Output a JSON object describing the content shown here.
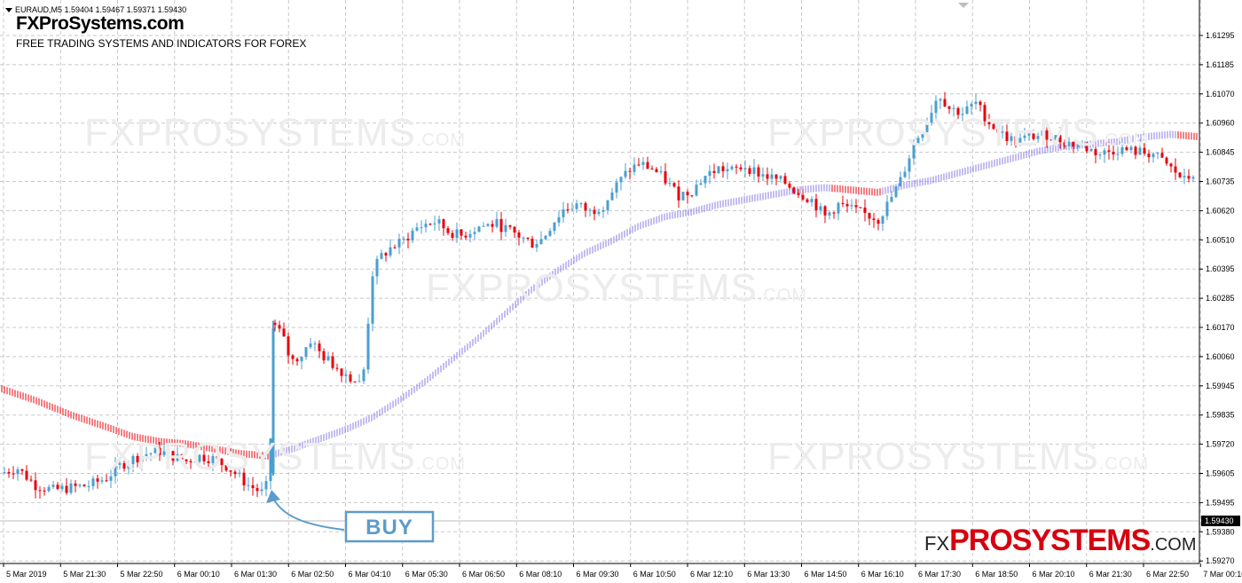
{
  "header": {
    "symbol_line": "EURAUD,M5  1.59404 1.59467 1.59371 1.59430",
    "site_name": "FXProSystems.com",
    "tagline": "FREE TRADING SYSTEMS AND INDICATORS FOR FOREX"
  },
  "watermark": {
    "main": "FXPROSYSTEMS",
    "suffix": ".COM"
  },
  "brand_logo": {
    "prefix": "FX",
    "main": "PROSYSTEMS",
    "suffix": ".COM"
  },
  "buy_label": "BUY",
  "price_labels": [
    "1.61295",
    "1.61185",
    "1.61070",
    "1.60960",
    "1.60845",
    "1.60735",
    "1.60620",
    "1.60510",
    "1.60395",
    "1.60285",
    "1.60170",
    "1.60060",
    "1.59945",
    "1.59835",
    "1.59720",
    "1.59605",
    "1.59495",
    "1.59380",
    "1.59270"
  ],
  "current_price": "1.59430",
  "time_labels": [
    "5 Mar 2019",
    "5 Mar 21:30",
    "5 Mar 22:50",
    "6 Mar 00:10",
    "6 Mar 01:30",
    "6 Mar 02:50",
    "6 Mar 04:10",
    "6 Mar 05:30",
    "6 Mar 06:50",
    "6 Mar 08:10",
    "6 Mar 09:30",
    "6 Mar 10:50",
    "6 Mar 12:10",
    "6 Mar 13:30",
    "6 Mar 14:50",
    "6 Mar 16:10",
    "6 Mar 17:30",
    "6 Mar 18:50",
    "6 Mar 20:10",
    "6 Mar 21:30",
    "6 Mar 22:50",
    "7 Mar 00:10"
  ],
  "colors": {
    "bull": "#4a9fcf",
    "bear": "#e8000b",
    "ma_up": "#8a7ee6",
    "ma_down": "#e8000b",
    "grid": "#c8c8c8",
    "buy_box": "#5d9cc9"
  },
  "chart_data": {
    "type": "candlestick",
    "symbol": "EURAUD",
    "timeframe": "M5",
    "y_range": [
      1.5922,
      1.614
    ],
    "price_series": [
      [
        0,
        1.5959
      ],
      [
        20,
        1.5961
      ],
      [
        40,
        1.5954
      ],
      [
        60,
        1.5952
      ],
      [
        80,
        1.5953
      ],
      [
        100,
        1.5954
      ],
      [
        120,
        1.5957
      ],
      [
        135,
        1.5962
      ],
      [
        150,
        1.5965
      ],
      [
        165,
        1.5967
      ],
      [
        180,
        1.5968
      ],
      [
        195,
        1.5966
      ],
      [
        210,
        1.5964
      ],
      [
        225,
        1.5966
      ],
      [
        240,
        1.5965
      ],
      [
        255,
        1.5962
      ],
      [
        268,
        1.5958
      ],
      [
        280,
        1.5954
      ],
      [
        295,
        1.5951
      ],
      [
        303,
        1.5955
      ],
      [
        310,
        1.602
      ],
      [
        318,
        1.6016
      ],
      [
        328,
        1.6005
      ],
      [
        340,
        1.6008
      ],
      [
        350,
        1.6014
      ],
      [
        362,
        1.6008
      ],
      [
        375,
        1.6004
      ],
      [
        390,
        1.6
      ],
      [
        405,
        1.5996
      ],
      [
        412,
        1.6004
      ],
      [
        418,
        1.604
      ],
      [
        428,
        1.6048
      ],
      [
        440,
        1.6052
      ],
      [
        455,
        1.6055
      ],
      [
        468,
        1.606
      ],
      [
        480,
        1.6062
      ],
      [
        492,
        1.6063
      ],
      [
        505,
        1.6059
      ],
      [
        520,
        1.6057
      ],
      [
        540,
        1.6061
      ],
      [
        560,
        1.6062
      ],
      [
        580,
        1.6058
      ],
      [
        600,
        1.6054
      ],
      [
        612,
        1.6056
      ],
      [
        622,
        1.6062
      ],
      [
        635,
        1.6068
      ],
      [
        650,
        1.607
      ],
      [
        665,
        1.6067
      ],
      [
        680,
        1.607
      ],
      [
        695,
        1.6078
      ],
      [
        708,
        1.6084
      ],
      [
        720,
        1.6087
      ],
      [
        735,
        1.6085
      ],
      [
        750,
        1.608
      ],
      [
        765,
        1.6074
      ],
      [
        780,
        1.6076
      ],
      [
        795,
        1.6082
      ],
      [
        810,
        1.6085
      ],
      [
        825,
        1.6084
      ],
      [
        840,
        1.6086
      ],
      [
        855,
        1.6083
      ],
      [
        870,
        1.6081
      ],
      [
        885,
        1.6079
      ],
      [
        900,
        1.6075
      ],
      [
        915,
        1.6072
      ],
      [
        930,
        1.6065
      ],
      [
        945,
        1.607
      ],
      [
        960,
        1.6068
      ],
      [
        975,
        1.6066
      ],
      [
        990,
        1.6064
      ],
      [
        1002,
        1.6071
      ],
      [
        1015,
        1.608
      ],
      [
        1030,
        1.6095
      ],
      [
        1045,
        1.6105
      ],
      [
        1058,
        1.6116
      ],
      [
        1070,
        1.611
      ],
      [
        1085,
        1.6108
      ],
      [
        1100,
        1.6112
      ],
      [
        1115,
        1.6104
      ],
      [
        1130,
        1.6099
      ],
      [
        1145,
        1.6096
      ],
      [
        1160,
        1.6098
      ],
      [
        1180,
        1.6099
      ],
      [
        1200,
        1.6096
      ],
      [
        1220,
        1.6094
      ],
      [
        1240,
        1.6091
      ],
      [
        1260,
        1.6093
      ],
      [
        1280,
        1.6092
      ],
      [
        1300,
        1.6091
      ],
      [
        1320,
        1.6085
      ],
      [
        1335,
        1.608
      ],
      [
        1350,
        1.6084
      ]
    ],
    "moving_average": [
      [
        0,
        1.5993
      ],
      [
        40,
        1.5988
      ],
      [
        80,
        1.5982
      ],
      [
        120,
        1.5977
      ],
      [
        150,
        1.5973
      ],
      [
        180,
        1.5971
      ],
      [
        210,
        1.597
      ],
      [
        240,
        1.5968
      ],
      [
        270,
        1.5966
      ],
      [
        303,
        1.5965
      ],
      [
        330,
        1.5968
      ],
      [
        360,
        1.5972
      ],
      [
        390,
        1.5976
      ],
      [
        420,
        1.5981
      ],
      [
        450,
        1.5988
      ],
      [
        480,
        1.5996
      ],
      [
        510,
        1.6005
      ],
      [
        540,
        1.6014
      ],
      [
        570,
        1.6024
      ],
      [
        600,
        1.6034
      ],
      [
        630,
        1.6042
      ],
      [
        660,
        1.6049
      ],
      [
        690,
        1.6054
      ],
      [
        720,
        1.606
      ],
      [
        750,
        1.6064
      ],
      [
        780,
        1.6066
      ],
      [
        810,
        1.6069
      ],
      [
        840,
        1.6071
      ],
      [
        870,
        1.6073
      ],
      [
        900,
        1.6075
      ],
      [
        930,
        1.6076
      ],
      [
        960,
        1.6075
      ],
      [
        990,
        1.6074
      ],
      [
        1020,
        1.6077
      ],
      [
        1050,
        1.6079
      ],
      [
        1080,
        1.6082
      ],
      [
        1110,
        1.6085
      ],
      [
        1140,
        1.6088
      ],
      [
        1170,
        1.6091
      ],
      [
        1200,
        1.6093
      ],
      [
        1230,
        1.6094
      ],
      [
        1260,
        1.6095
      ],
      [
        1290,
        1.6097
      ],
      [
        1320,
        1.6098
      ],
      [
        1352,
        1.6097
      ]
    ]
  }
}
